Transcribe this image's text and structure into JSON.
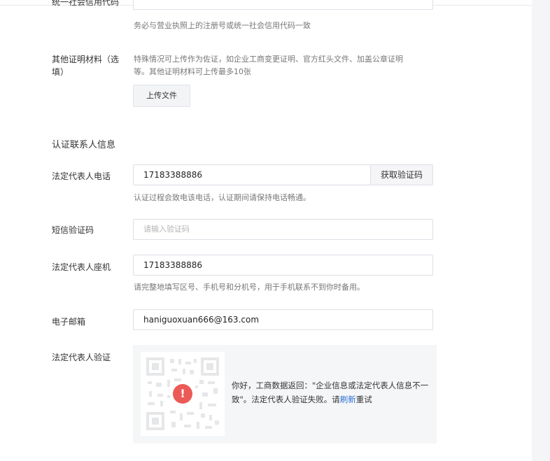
{
  "top_field": {
    "label_partial": "统一社会信用代码",
    "input_value_partial": "",
    "hint": "务必与营业执照上的注册号或统一社会信用代码一致"
  },
  "other_docs": {
    "label_line1": "其他证明材料（选",
    "label_line2": "填）",
    "desc_line1": "特殊情况可上传作为佐证，如企业工商变更证明、官方红头文件、加盖公章证明",
    "desc_line2": "等。其他证明材料可上传最多10张",
    "upload_label": "上传文件"
  },
  "section_title": "认证联系人信息",
  "legal_phone": {
    "label": "法定代表人电话",
    "value": "17183388886",
    "get_code_label": "获取验证码",
    "hint": "认证过程会致电该电话，认证期间请保持电话畅通。"
  },
  "sms_code": {
    "label": "短信验证码",
    "placeholder": "请输入验证码"
  },
  "legal_landline": {
    "label": "法定代表人座机",
    "value": "17183388886",
    "hint": "请完整地填写区号、手机号和分机号，用于手机联系不到你时备用。"
  },
  "email": {
    "label": "电子邮箱",
    "value": "haniguoxuan666@163.com"
  },
  "legal_verify": {
    "label": "法定代表人验证",
    "msg_prefix": "你好，工商数据返回：\"企业信息或法定代表人信息不一致\"。法定代表人验证失败。请",
    "refresh_label": "刷新",
    "msg_suffix": "重试"
  },
  "icons": {
    "error": "error-circle-icon",
    "qr": "qr-code-icon"
  },
  "colors": {
    "error": "#ec5a57",
    "link": "#2b6fd1"
  }
}
